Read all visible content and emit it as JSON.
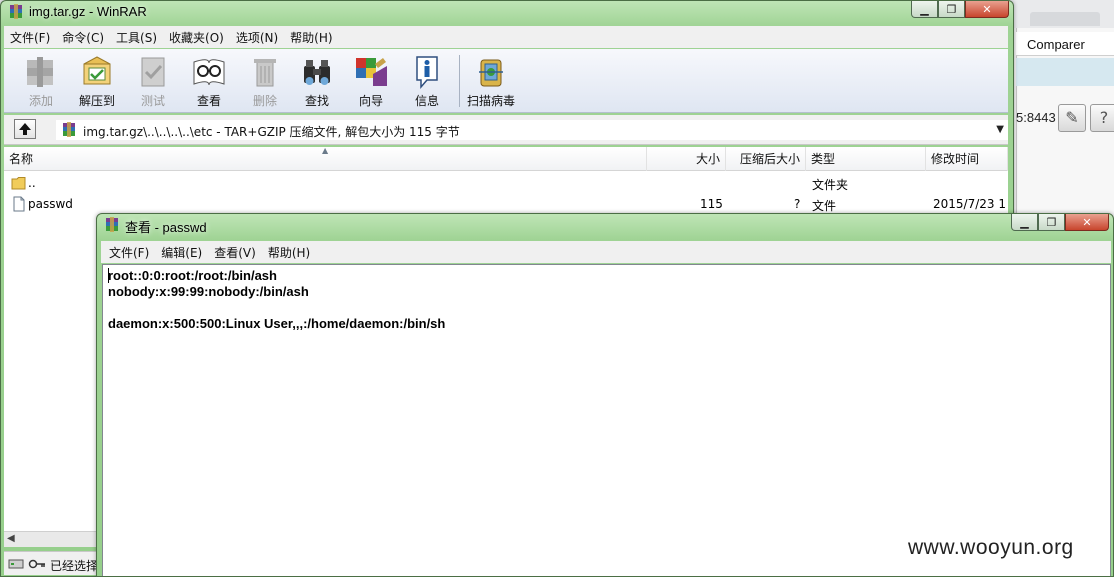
{
  "background": {
    "comparer_tab": "Comparer",
    "port_text": "5:8443"
  },
  "winrar": {
    "title": "img.tar.gz - WinRAR",
    "menu": [
      "文件(F)",
      "命令(C)",
      "工具(S)",
      "收藏夹(O)",
      "选项(N)",
      "帮助(H)"
    ],
    "toolbar": [
      {
        "label": "添加",
        "enabled": false,
        "icon": "add-icon"
      },
      {
        "label": "解压到",
        "enabled": true,
        "icon": "extract-icon"
      },
      {
        "label": "测试",
        "enabled": false,
        "icon": "test-icon"
      },
      {
        "label": "查看",
        "enabled": true,
        "icon": "view-icon"
      },
      {
        "label": "删除",
        "enabled": false,
        "icon": "delete-icon"
      },
      {
        "label": "查找",
        "enabled": true,
        "icon": "find-icon"
      },
      {
        "label": "向导",
        "enabled": true,
        "icon": "wizard-icon"
      },
      {
        "label": "信息",
        "enabled": true,
        "icon": "info-icon"
      },
      {
        "label": "扫描病毒",
        "enabled": true,
        "icon": "virus-scan-icon"
      }
    ],
    "address": "img.tar.gz\\..\\..\\..\\..\\etc - TAR+GZIP 压缩文件, 解包大小为 115 字节",
    "columns": {
      "name": "名称",
      "size": "大小",
      "packed": "压缩后大小",
      "type": "类型",
      "modified": "修改时间"
    },
    "files": [
      {
        "name": "..",
        "size": "",
        "packed": "",
        "type": "文件夹",
        "modified": ""
      },
      {
        "name": "passwd",
        "size": "115",
        "packed": "?",
        "type": "文件",
        "modified": "2015/7/23 1"
      }
    ],
    "status": "已经选择"
  },
  "viewer": {
    "title": "查看 - passwd",
    "menu": [
      "文件(F)",
      "编辑(E)",
      "查看(V)",
      "帮助(H)"
    ],
    "content": "root::0:0:root:/root:/bin/ash\nnobody:x:99:99:nobody:/bin/ash\n\ndaemon:x:500:500:Linux User,,,:/home/daemon:/bin/sh"
  },
  "watermark": "www.wooyun.org"
}
